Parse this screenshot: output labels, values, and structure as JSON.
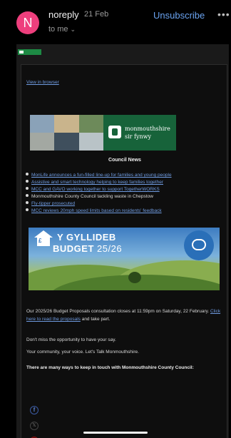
{
  "header": {
    "avatar_letter": "N",
    "sender": "noreply",
    "date": "21 Feb",
    "recipient": "to me",
    "unsubscribe": "Unsubscribe",
    "more": "•••"
  },
  "email": {
    "view_in_browser": "View in browser",
    "brand_line1": "monmouthshire",
    "brand_line2": "sir fynwy",
    "section_title": "Council News",
    "news_items": [
      {
        "text": "MonLife announces a fun-filled line-up for families and young people",
        "link": true
      },
      {
        "text": "Assistive and smart technology helping to keep families together",
        "link": true
      },
      {
        "text": "MCC and GAVO working together to support TogetherWORKS",
        "link": true
      },
      {
        "text": "Monmouthshire County Council tackling waste in Chepstow",
        "link": false
      },
      {
        "text": "Fly-tipper prosecuted",
        "link": true
      },
      {
        "text": "MCC reviews 20mph speed limits based on residents' feedback",
        "link": true
      }
    ],
    "budget_banner": {
      "line1": "Y GYLLIDEB",
      "line2": "BUDGET",
      "year": "25/26",
      "pound": "£"
    },
    "paragraph1_before": "Our 2025/26 Budget Proposals consultation closes at 11:59pm on Saturday, 22 February.",
    "paragraph1_link": "Click here to read the proposals",
    "paragraph1_after": "and take part.",
    "paragraph2": "Don't miss the opportunity to have your say.",
    "paragraph3": "Your community, your voice. Let's Talk Monmouthshire.",
    "paragraph4": "There are many ways to keep in touch with Monmouthshire County Council:",
    "social": {
      "facebook": "f",
      "x": "𝕏"
    }
  },
  "colors": {
    "avatar": "#ee3f7d",
    "link": "#6f9be0",
    "unsubscribe": "#6aa3f0",
    "brand_green": "#17633a"
  },
  "icons": [
    "chevron-down-icon",
    "more-icon",
    "facebook-icon",
    "x-icon",
    "youtube-icon",
    "chat-bubble-icon",
    "house-icon"
  ]
}
